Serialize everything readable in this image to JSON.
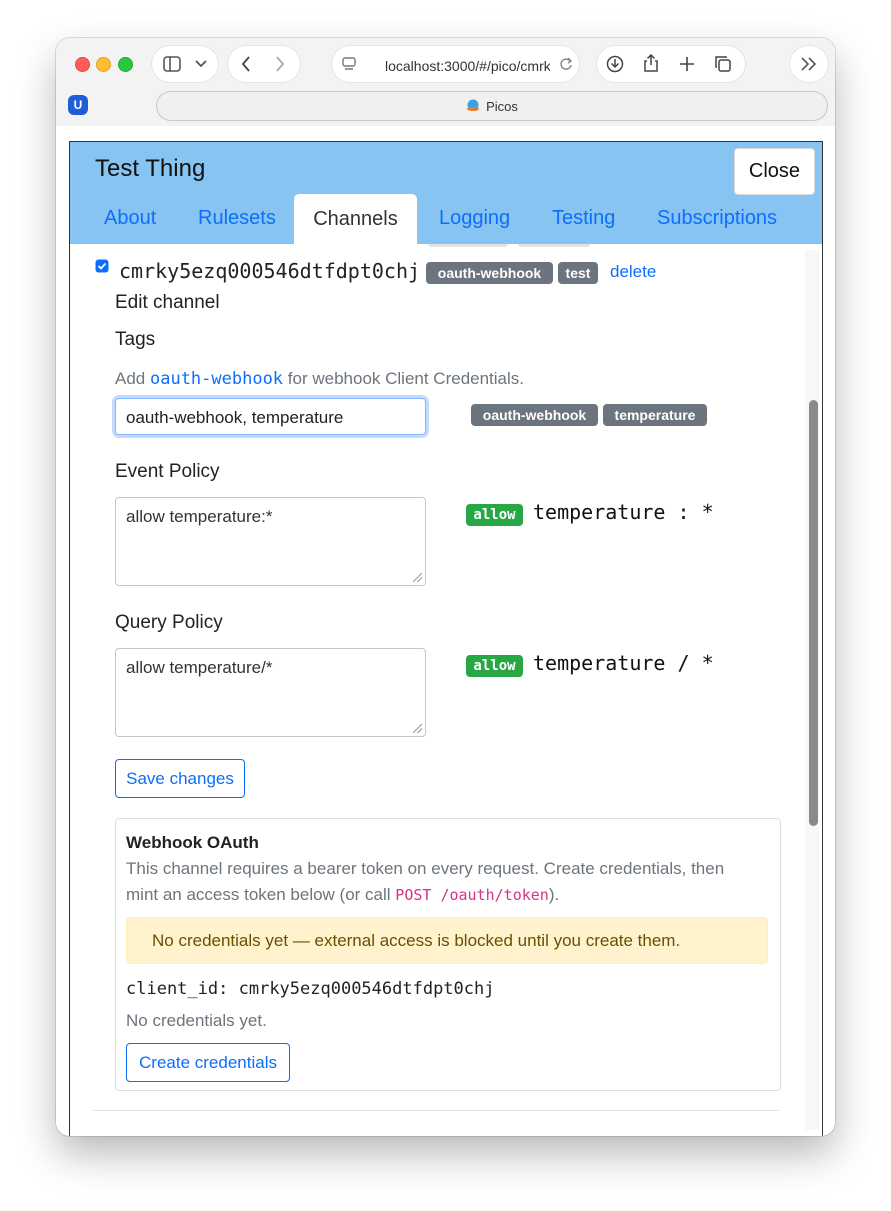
{
  "browser": {
    "url": "localhost:3000/#/pico/cmrk",
    "tab_title": "Picos",
    "extension_letter": "U"
  },
  "modal": {
    "title": "Test Thing",
    "close_label": "Close",
    "tabs": [
      {
        "label": "About",
        "active": false
      },
      {
        "label": "Rulesets",
        "active": false
      },
      {
        "label": "Channels",
        "active": true
      },
      {
        "label": "Logging",
        "active": false
      },
      {
        "label": "Testing",
        "active": false
      },
      {
        "label": "Subscriptions",
        "active": false
      }
    ]
  },
  "channel": {
    "checked": true,
    "id": "cmrky5ezq000546dtfdpt0chj",
    "tags": [
      "oauth-webhook",
      "test"
    ],
    "delete_label": "delete"
  },
  "edit": {
    "heading": "Edit channel",
    "tags_label": "Tags",
    "hint_prefix": "Add",
    "hint_code": "oauth-webhook",
    "hint_suffix": "for webhook Client Credentials.",
    "tags_value": "oauth-webhook, temperature",
    "tags_preview": [
      "oauth-webhook",
      "temperature"
    ],
    "event_policy_label": "Event Policy",
    "event_policy_value": "allow temperature:*",
    "event_preview_badge": "allow",
    "event_preview_text": "temperature : *",
    "query_policy_label": "Query Policy",
    "query_policy_value": "allow temperature/*",
    "query_preview_badge": "allow",
    "query_preview_text": "temperature / *",
    "save_label": "Save changes"
  },
  "oauth": {
    "title": "Webhook OAuth",
    "desc_line1": "This channel requires a bearer token on every request. Create credentials, then",
    "desc_line2_prefix": "mint an access token below (or call",
    "desc_code": "POST /oauth/token",
    "desc_line2_suffix": ").",
    "alert": "No credentials yet — external access is blocked until you create them.",
    "client_id_label": "client_id:",
    "client_id": "cmrky5ezq000546dtfdpt0chj",
    "empty_text": "No credentials yet.",
    "create_label": "Create credentials"
  },
  "colors": {
    "header_bg": "#87c4f1",
    "link": "#0d6efd",
    "badge_gray": "#6c757d",
    "badge_green": "#28a745",
    "code_pink": "#d63384",
    "alert_bg": "#fff3cd"
  }
}
